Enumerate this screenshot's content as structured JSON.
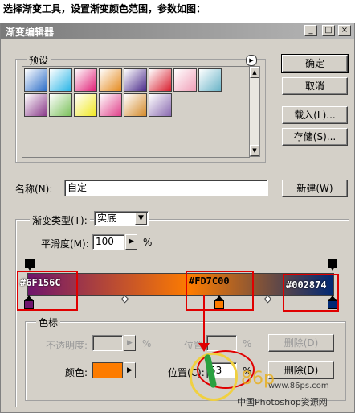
{
  "caption": "选择渐变工具，设置渐变颜色范围，参数如图：",
  "window": {
    "title": "渐变编辑器",
    "min_label": "_",
    "max_label": "□",
    "close_label": "×"
  },
  "presets": {
    "legend": "预设",
    "menu_arrow": "▶",
    "scroll_up": "▲",
    "scroll_down": "▼",
    "row1": [
      "#2e6fc8",
      "#27b4e6",
      "#e01f76",
      "#e58a1e",
      "#4a2a8a",
      "#d81e2e",
      "#f0a0b8",
      "#6ab4c8"
    ],
    "row2": [
      "#8a3a8a",
      "#7ac05a",
      "#f0e820",
      "#e0408a",
      "#d48a2a",
      "#8a6ab0"
    ]
  },
  "buttons": {
    "ok": "确定",
    "cancel": "取消",
    "load": "载入(L)...",
    "save": "存储(S)...",
    "new": "新建(W)",
    "delete_opacity": "删除(D)",
    "delete_color": "删除(D)"
  },
  "name": {
    "label": "名称(N):",
    "value": "自定"
  },
  "gradient": {
    "legend_type": "渐变类型(T):",
    "type_value": "实底",
    "smooth_label": "平滑度(M):",
    "smooth_value": "100",
    "percent": "%",
    "stop1_hex": "#6F156C",
    "stop2_hex": "#FD7C00",
    "stop3_hex": "#002874",
    "colors": {
      "stop1": "#6f156c",
      "stop2": "#fd7c00",
      "stop3": "#002874"
    }
  },
  "stops": {
    "legend": "色标",
    "opacity_label": "不透明度:",
    "opacity_value": "",
    "opacity_percent": "%",
    "location_label_1": "位置:",
    "location_percent_1": "%",
    "color_label": "颜色:",
    "color_value": "#fd7c00",
    "location_label_2": "位置(C):",
    "location_value": "53",
    "location_percent_2": "%"
  },
  "watermark": {
    "url": "www.86ps.com",
    "site_name": "中国Photoshop资源网",
    "logo_text": "86p"
  }
}
